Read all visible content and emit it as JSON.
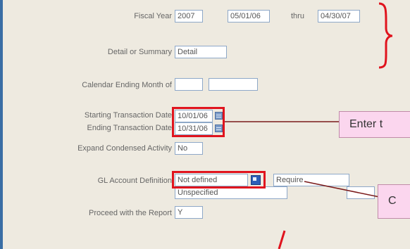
{
  "fiscal_year": {
    "label": "Fiscal Year",
    "year": "2007",
    "start_date": "05/01/06",
    "thru_label": "thru",
    "end_date": "04/30/07"
  },
  "detail_summary": {
    "label": "Detail or Summary",
    "value": "Detail"
  },
  "calendar_ending": {
    "label": "Calendar Ending Month of",
    "month": "",
    "year": ""
  },
  "starting_date": {
    "label": "Starting Transaction Date",
    "value": "10/01/06"
  },
  "ending_date": {
    "label": "Ending Transaction Date",
    "value": "10/31/06"
  },
  "expand_condensed": {
    "label": "Expand Condensed Activity",
    "value": "No"
  },
  "gl_account": {
    "label": "GL Account Definition",
    "value": "Not defined",
    "required_value": "Require",
    "unspecified_value": "Unspecified",
    "right_value": ""
  },
  "proceed": {
    "label": "Proceed with the Report",
    "value": "Y"
  },
  "callouts": {
    "enter": "Enter t",
    "choose": "C"
  },
  "colors": {
    "highlight": "#e0141e",
    "callout_bg": "#fbd6ee",
    "field_border": "#8ea8c8"
  }
}
